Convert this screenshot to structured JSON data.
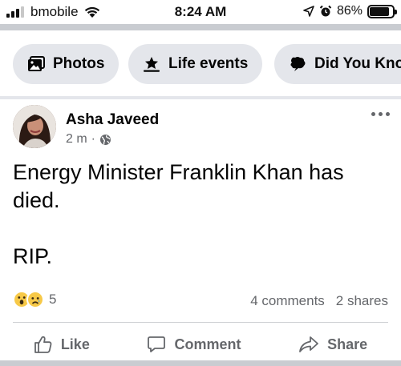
{
  "status_bar": {
    "carrier": "bmobile",
    "time": "8:24 AM",
    "battery_percent": "86%",
    "battery_level": 0.86
  },
  "chips": [
    {
      "label": "Photos",
      "icon": "photos-icon"
    },
    {
      "label": "Life events",
      "icon": "life-events-icon"
    },
    {
      "label": "Did You Kno",
      "icon": "chat-bubble-icon"
    }
  ],
  "post": {
    "author": "Asha Javeed",
    "time_ago": "2 m",
    "separator": "·",
    "privacy_icon": "globe-icon",
    "text_line1": "Energy Minister Franklin Khan has",
    "text_line2": "died.",
    "text_line3": "RIP.",
    "reaction_count": "5",
    "reaction_icons": [
      "wow-emoji-icon",
      "sad-emoji-icon"
    ],
    "comments": "4 comments",
    "shares": "2 shares"
  },
  "actions": {
    "like": "Like",
    "comment": "Comment",
    "share": "Share"
  },
  "colors": {
    "chip_bg": "#e4e6eb",
    "secondary_text": "#65676b",
    "divider": "#c9ccd1"
  }
}
